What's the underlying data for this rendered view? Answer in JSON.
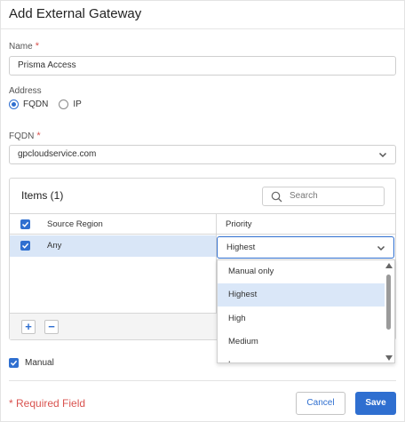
{
  "dialog": {
    "title": "Add External Gateway",
    "required_mark": "*"
  },
  "name_field": {
    "label": "Name",
    "value": "Prisma Access"
  },
  "address": {
    "label": "Address",
    "options": [
      "FQDN",
      "IP"
    ],
    "selected": "FQDN"
  },
  "fqdn_field": {
    "label": "FQDN",
    "value": "gpcloudservice.com"
  },
  "items": {
    "title": "Items (1)",
    "search_placeholder": "Search",
    "columns": [
      "Source Region",
      "Priority"
    ],
    "rows": [
      {
        "source_region": "Any",
        "priority": "Highest",
        "checked": true
      }
    ],
    "add_label": "+",
    "remove_label": "−"
  },
  "priority_dropdown": {
    "selected": "Highest",
    "options": [
      "Manual only",
      "Highest",
      "High",
      "Medium",
      "Low"
    ],
    "highlighted": "Highest"
  },
  "manual": {
    "label": "Manual",
    "checked": true
  },
  "footer": {
    "required_note": "Required Field",
    "cancel_label": "Cancel",
    "save_label": "Save"
  },
  "colors": {
    "accent": "#2f6fd0",
    "required": "#d9534f",
    "selected_row": "#d9e6f7"
  }
}
